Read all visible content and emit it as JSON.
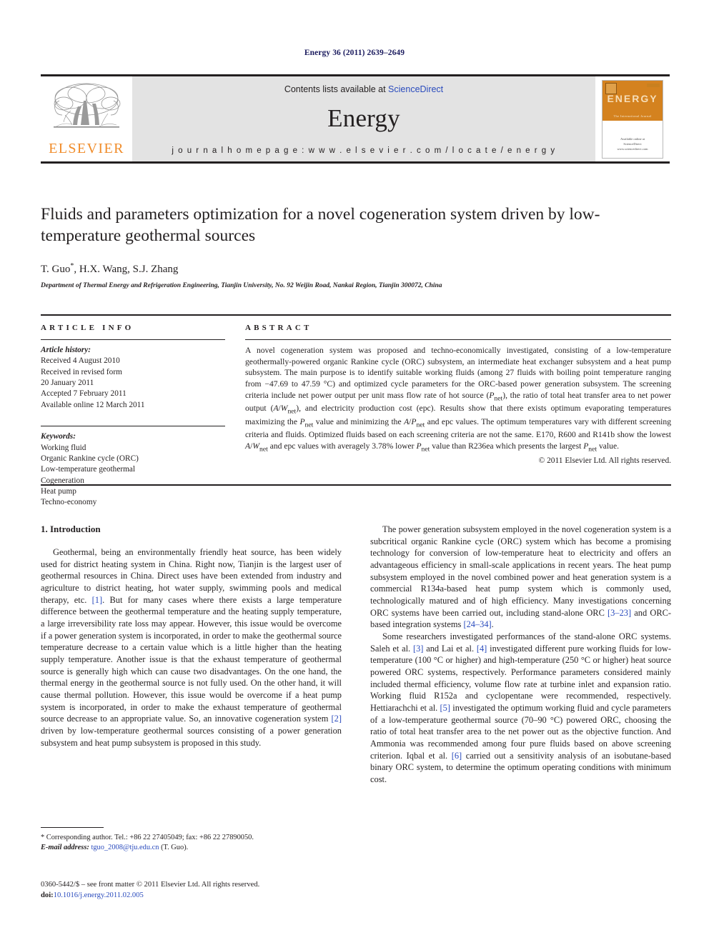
{
  "running_head": "Energy 36 (2011) 2639–2649",
  "masthead": {
    "contents_prefix": "Contents lists available at ",
    "sciencedirect": "ScienceDirect",
    "journal_title": "Energy",
    "homepage": "j o u r n a l   h o m e p a g e :   w w w . e l s e v i e r . c o m / l o c a t e / e n e r g y",
    "elsevier_wordmark": "ELSEVIER",
    "cover": {
      "title": "ENERGY",
      "tagline": "The International Journal",
      "footer_top": "Available online at",
      "footer_mid": "ScienceDirect",
      "footer_bot": "www.sciencedirect.com"
    },
    "accent_orange": "#f08c2a",
    "link_blue": "#2a4bbd",
    "band_gray": "#e3e3e3"
  },
  "article": {
    "title": "Fluids and parameters optimization for a novel cogeneration system driven by low-temperature geothermal sources",
    "authors": "T. Guo*, H.X. Wang, S.J. Zhang",
    "affiliation": "Department of Thermal Energy and Refrigeration Engineering, Tianjin University, No. 92 Weijin Road, Nankai Region, Tianjin 300072, China"
  },
  "article_info": {
    "heading": "ARTICLE INFO",
    "history_label": "Article history:",
    "history": [
      "Received 4 August 2010",
      "Received in revised form",
      "20 January 2011",
      "Accepted 7 February 2011",
      "Available online 12 March 2011"
    ],
    "keywords_label": "Keywords:",
    "keywords": [
      "Working fluid",
      "Organic Rankine cycle (ORC)",
      "Low-temperature geothermal",
      "Cogeneration",
      "Heat pump",
      "Techno-economy"
    ]
  },
  "abstract": {
    "heading": "ABSTRACT",
    "text": "A novel cogeneration system was proposed and techno-economically investigated, consisting of a low-temperature geothermally-powered organic Rankine cycle (ORC) subsystem, an intermediate heat exchanger subsystem and a heat pump subsystem. The main purpose is to identify suitable working fluids (among 27 fluids with boiling point temperature ranging from −47.69 to 47.59 °C) and optimized cycle parameters for the ORC-based power generation subsystem. The screening criteria include net power output per unit mass flow rate of hot source (Pnet), the ratio of total heat transfer area to net power output (A/Wnet), and electricity production cost (epc). Results show that there exists optimum evaporating temperatures maximizing the Pnet value and minimizing the A/Pnet and epc values. The optimum temperatures vary with different screening criteria and fluids. Optimized fluids based on each screening criteria are not the same. E170, R600 and R141b show the lowest A/Wnet and epc values with averagely 3.78% lower Pnet value than R236ea which presents the largest Pnet value.",
    "copyright": "© 2011 Elsevier Ltd. All rights reserved."
  },
  "body": {
    "section_number_title": "1. Introduction",
    "left_paragraphs": [
      "Geothermal, being an environmentally friendly heat source, has been widely used for district heating system in China. Right now, Tianjin is the largest user of geothermal resources in China. Direct uses have been extended from industry and agriculture to district heating, hot water supply, swimming pools and medical therapy, etc. [1]. But for many cases where there exists a large temperature difference between the geothermal temperature and the heating supply temperature, a large irreversibility rate loss may appear. However, this issue would be overcome if a power generation system is incorporated, in order to make the geothermal source temperature decrease to a certain value which is a little higher than the heating supply temperature. Another issue is that the exhaust temperature of geothermal source is generally high which can cause two disadvantages. On the one hand, the thermal energy in the geothermal source is not fully used. On the other hand, it will cause thermal pollution. However, this issue would be overcome if a heat pump system is incorporated, in order to make the exhaust temperature of geothermal source decrease to an appropriate value. So, an innovative cogeneration system [2] driven by low-temperature geothermal sources consisting of a power generation subsystem and heat pump subsystem is proposed in this study."
    ],
    "right_paragraphs": [
      "The power generation subsystem employed in the novel cogeneration system is a subcritical organic Rankine cycle (ORC) system which has become a promising technology for conversion of low-temperature heat to electricity and offers an advantageous efficiency in small-scale applications in recent years. The heat pump subsystem employed in the novel combined power and heat generation system is a commercial R134a-based heat pump system which is commonly used, technologically matured and of high efficiency. Many investigations concerning ORC systems have been carried out, including stand-alone ORC [3–23] and ORC-based integration systems [24–34].",
      "Some researchers investigated performances of the stand-alone ORC systems. Saleh et al. [3] and Lai et al. [4] investigated different pure working fluids for low-temperature (100 °C or higher) and high-temperature (250 °C or higher) heat source powered ORC systems, respectively. Performance parameters considered mainly included thermal efficiency, volume flow rate at turbine inlet and expansion ratio. Working fluid R152a and cyclopentane were recommended, respectively. Hettiarachchi et al. [5] investigated the optimum working fluid and cycle parameters of a low-temperature geothermal source (70–90 °C) powered ORC, choosing the ratio of total heat transfer area to the net power out as the objective function. And Ammonia was recommended among four pure fluids based on above screening criterion. Iqbal et al. [6] carried out a sensitivity analysis of an isobutane-based binary ORC system, to determine the optimum operating conditions with minimum cost."
    ]
  },
  "footnote": {
    "corresponding": "* Corresponding author. Tel.: +86 22 27405049; fax: +86 22 27890050.",
    "email_label": "E-mail address:",
    "email": "tguo_2008@tju.edu.cn",
    "email_suffix": "(T. Guo)."
  },
  "footer": {
    "issn_line": "0360-5442/$ – see front matter © 2011 Elsevier Ltd. All rights reserved.",
    "doi_label": "doi:",
    "doi": "10.1016/j.energy.2011.02.005"
  }
}
